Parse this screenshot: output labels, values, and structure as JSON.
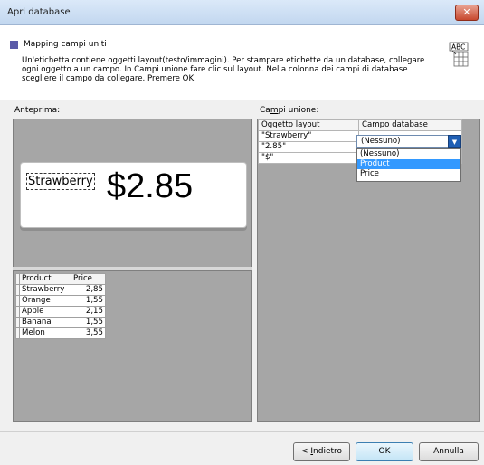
{
  "window": {
    "title": "Apri database",
    "close_symbol": "✕"
  },
  "header": {
    "title": "Mapping campi uniti",
    "description": "Un'etichetta contiene oggetti layout(testo/immagini). Per stampare etichette da un database, collegare ogni oggetto a un campo. In Campi unione fare clic sul layout. Nella colonna dei campi di database scegliere il campo da collegare. Premere OK.",
    "icon": "abc-merge-icon",
    "icon_text": "ABC"
  },
  "preview": {
    "label": "Anteprima:",
    "layout_text": "Strawberry",
    "layout_price": "$2.85"
  },
  "data_table": {
    "headers": [
      "Product",
      "Price"
    ],
    "rows": [
      [
        "Strawberry",
        "2,85"
      ],
      [
        "Orange",
        "1,55"
      ],
      [
        "Apple",
        "2,15"
      ],
      [
        "Banana",
        "1,55"
      ],
      [
        "Melon",
        "3,55"
      ]
    ]
  },
  "merge": {
    "label_prefix": "Ca",
    "label_underlined": "m",
    "label_suffix": "pi unione:",
    "headers": [
      "Oggetto layout",
      "Campo database"
    ],
    "rows": [
      {
        "object": "\"Strawberry\"",
        "field": "(Nessuno)"
      },
      {
        "object": "\"2.85\"",
        "field": ""
      },
      {
        "object": "\"$\"",
        "field": ""
      }
    ],
    "combo_value": "(Nessuno)",
    "dropdown_options": [
      "(Nessuno)",
      "Product",
      "Price"
    ],
    "dropdown_selected": "Product"
  },
  "buttons": {
    "back_prefix": "< ",
    "back_underlined": "I",
    "back_suffix": "ndietro",
    "ok": "OK",
    "cancel": "Annulla"
  },
  "colors": {
    "selection": "#3399ff",
    "panel": "#a6a6a6",
    "combo_arrow": "#1f5fb4"
  }
}
